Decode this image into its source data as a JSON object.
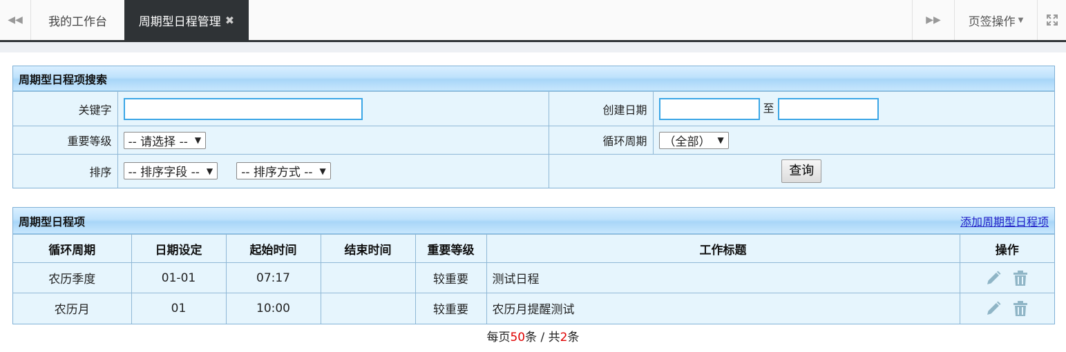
{
  "tabbar": {
    "tabs": [
      {
        "label": "我的工作台",
        "active": false
      },
      {
        "label": "周期型日程管理",
        "active": true,
        "close_glyph": "✖"
      }
    ],
    "ops_label": "页签操作"
  },
  "search_panel": {
    "title": "周期型日程项搜索",
    "keyword_label": "关键字",
    "keyword_value": "",
    "created_label": "创建日期",
    "date_from": "",
    "date_sep": "至",
    "date_to": "",
    "importance_label": "重要等级",
    "importance_selected": "-- 请选择 --",
    "cycle_label": "循环周期",
    "cycle_selected": "（全部）",
    "sort_label": "排序",
    "sort_field_selected": "-- 排序字段 --",
    "sort_order_selected": "-- 排序方式 --",
    "query_button": "查询"
  },
  "list_panel": {
    "title": "周期型日程项",
    "add_link": "添加周期型日程项",
    "columns": [
      "循环周期",
      "日期设定",
      "起始时间",
      "结束时间",
      "重要等级",
      "工作标题",
      "操作"
    ],
    "rows": [
      {
        "cycle": "农历季度",
        "date": "01-01",
        "start": "07:17",
        "end": "",
        "importance": "较重要",
        "title": "测试日程"
      },
      {
        "cycle": "农历月",
        "date": "01",
        "start": "10:00",
        "end": "",
        "importance": "较重要",
        "title": "农历月提醒测试"
      }
    ]
  },
  "pager": {
    "prefix": "每页",
    "page_size": "50",
    "mid": "条 / 共",
    "total": "2",
    "suffix": "条"
  },
  "icons": {
    "prev": "double-chevron-left-icon",
    "next": "double-chevron-right-icon",
    "fullscreen": "fullscreen-icon",
    "edit": "pencil-icon",
    "delete": "trash-icon"
  },
  "colors": {
    "accent_dark": "#2f3336",
    "panel_bg": "#e6f5fd",
    "input_border": "#3aa6e6",
    "link": "#2020c8",
    "pager_number": "#e00000",
    "action_icon": "#8fb5c6"
  }
}
